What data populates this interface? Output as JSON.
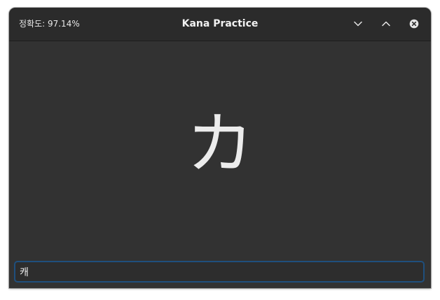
{
  "window": {
    "title": "Kana Practice",
    "accuracy": "정확도: 97.14%"
  },
  "controls": {
    "minimize_icon": "chevron-down-icon",
    "maximize_icon": "chevron-up-icon",
    "close_icon": "close-icon"
  },
  "practice": {
    "kana": "カ",
    "answer_value": "캐"
  },
  "colors": {
    "headerbar": "#2b2b2b",
    "background": "#323232",
    "focus_border": "#1f4f7d"
  }
}
